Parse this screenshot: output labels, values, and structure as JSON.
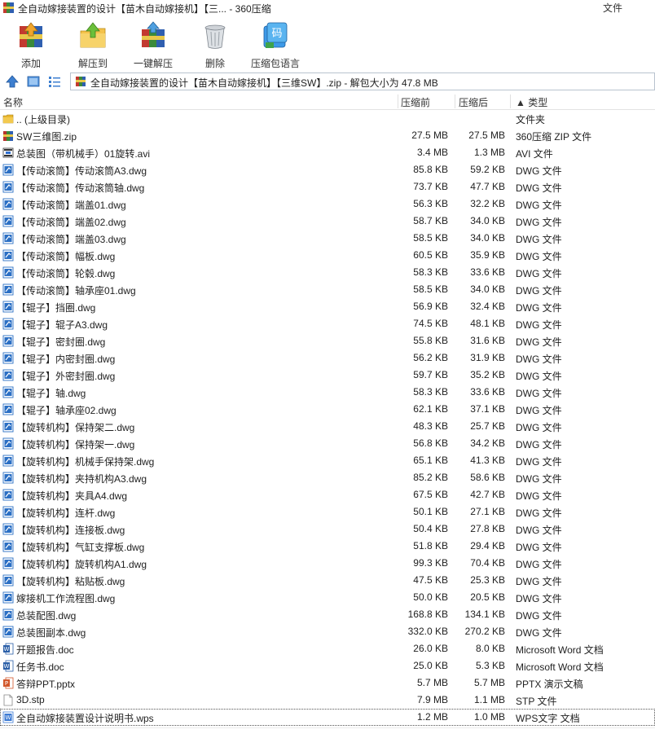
{
  "window": {
    "title": "全自动嫁接装置的设计【苗木自动嫁接机】【三... - 360压缩",
    "menu_file": "文件"
  },
  "toolbar": {
    "buttons": [
      {
        "label": "添加",
        "icon": "add-archive-icon"
      },
      {
        "label": "解压到",
        "icon": "extract-to-folder-icon"
      },
      {
        "label": "一键解压",
        "icon": "one-click-extract-icon"
      },
      {
        "label": "删除",
        "icon": "trash-bin-icon"
      },
      {
        "label": "压缩包语言",
        "icon": "archive-language-icon"
      }
    ],
    "language_badge": "码"
  },
  "address": {
    "path": "全自动嫁接装置的设计【苗木自动嫁接机】【三维SW】.zip - 解包大小为 47.8 MB"
  },
  "columns": {
    "name": "名称",
    "size": "压缩前",
    "compressed": "压缩后",
    "type": "▲ 类型"
  },
  "colors": {
    "folder": "#e8b62f",
    "dwg_blue": "#2b6fc4",
    "word_blue": "#2b5fa8",
    "ppt_orange": "#d2562a",
    "wps_blue": "#3d7bd4",
    "winrar_red": "#b8322c"
  },
  "files": [
    {
      "name": ".. (上级目录)",
      "size": "",
      "csize": "",
      "type": "文件夹",
      "icon": "folder-icon"
    },
    {
      "name": "SW三维图.zip",
      "size": "27.5 MB",
      "csize": "27.5 MB",
      "type": "360压缩 ZIP 文件",
      "icon": "zip-icon"
    },
    {
      "name": "总装图（带机械手）01旋转.avi",
      "size": "3.4 MB",
      "csize": "1.3 MB",
      "type": "AVI 文件",
      "icon": "video-file-icon"
    },
    {
      "name": "【传动滚筒】传动滚筒A3.dwg",
      "size": "85.8 KB",
      "csize": "59.2 KB",
      "type": "DWG 文件",
      "icon": "dwg-file-icon"
    },
    {
      "name": "【传动滚筒】传动滚筒轴.dwg",
      "size": "73.7 KB",
      "csize": "47.7 KB",
      "type": "DWG 文件",
      "icon": "dwg-file-icon"
    },
    {
      "name": "【传动滚筒】端盖01.dwg",
      "size": "56.3 KB",
      "csize": "32.2 KB",
      "type": "DWG 文件",
      "icon": "dwg-file-icon"
    },
    {
      "name": "【传动滚筒】端盖02.dwg",
      "size": "58.7 KB",
      "csize": "34.0 KB",
      "type": "DWG 文件",
      "icon": "dwg-file-icon"
    },
    {
      "name": "【传动滚筒】端盖03.dwg",
      "size": "58.5 KB",
      "csize": "34.0 KB",
      "type": "DWG 文件",
      "icon": "dwg-file-icon"
    },
    {
      "name": "【传动滚筒】幅板.dwg",
      "size": "60.5 KB",
      "csize": "35.9 KB",
      "type": "DWG 文件",
      "icon": "dwg-file-icon"
    },
    {
      "name": "【传动滚筒】轮毂.dwg",
      "size": "58.3 KB",
      "csize": "33.6 KB",
      "type": "DWG 文件",
      "icon": "dwg-file-icon"
    },
    {
      "name": "【传动滚筒】轴承座01.dwg",
      "size": "58.5 KB",
      "csize": "34.0 KB",
      "type": "DWG 文件",
      "icon": "dwg-file-icon"
    },
    {
      "name": "【辊子】挡圈.dwg",
      "size": "56.9 KB",
      "csize": "32.4 KB",
      "type": "DWG 文件",
      "icon": "dwg-file-icon"
    },
    {
      "name": "【辊子】辊子A3.dwg",
      "size": "74.5 KB",
      "csize": "48.1 KB",
      "type": "DWG 文件",
      "icon": "dwg-file-icon"
    },
    {
      "name": "【辊子】密封圈.dwg",
      "size": "55.8 KB",
      "csize": "31.6 KB",
      "type": "DWG 文件",
      "icon": "dwg-file-icon"
    },
    {
      "name": "【辊子】内密封圈.dwg",
      "size": "56.2 KB",
      "csize": "31.9 KB",
      "type": "DWG 文件",
      "icon": "dwg-file-icon"
    },
    {
      "name": "【辊子】外密封圈.dwg",
      "size": "59.7 KB",
      "csize": "35.2 KB",
      "type": "DWG 文件",
      "icon": "dwg-file-icon"
    },
    {
      "name": "【辊子】轴.dwg",
      "size": "58.3 KB",
      "csize": "33.6 KB",
      "type": "DWG 文件",
      "icon": "dwg-file-icon"
    },
    {
      "name": "【辊子】轴承座02.dwg",
      "size": "62.1 KB",
      "csize": "37.1 KB",
      "type": "DWG 文件",
      "icon": "dwg-file-icon"
    },
    {
      "name": "【旋转机构】保持架二.dwg",
      "size": "48.3 KB",
      "csize": "25.7 KB",
      "type": "DWG 文件",
      "icon": "dwg-file-icon"
    },
    {
      "name": "【旋转机构】保持架一.dwg",
      "size": "56.8 KB",
      "csize": "34.2 KB",
      "type": "DWG 文件",
      "icon": "dwg-file-icon"
    },
    {
      "name": "【旋转机构】机械手保持架.dwg",
      "size": "65.1 KB",
      "csize": "41.3 KB",
      "type": "DWG 文件",
      "icon": "dwg-file-icon"
    },
    {
      "name": "【旋转机构】夹持机构A3.dwg",
      "size": "85.2 KB",
      "csize": "58.6 KB",
      "type": "DWG 文件",
      "icon": "dwg-file-icon"
    },
    {
      "name": "【旋转机构】夹具A4.dwg",
      "size": "67.5 KB",
      "csize": "42.7 KB",
      "type": "DWG 文件",
      "icon": "dwg-file-icon"
    },
    {
      "name": "【旋转机构】连杆.dwg",
      "size": "50.1 KB",
      "csize": "27.1 KB",
      "type": "DWG 文件",
      "icon": "dwg-file-icon"
    },
    {
      "name": "【旋转机构】连接板.dwg",
      "size": "50.4 KB",
      "csize": "27.8 KB",
      "type": "DWG 文件",
      "icon": "dwg-file-icon"
    },
    {
      "name": "【旋转机构】气缸支撑板.dwg",
      "size": "51.8 KB",
      "csize": "29.4 KB",
      "type": "DWG 文件",
      "icon": "dwg-file-icon"
    },
    {
      "name": "【旋转机构】旋转机构A1.dwg",
      "size": "99.3 KB",
      "csize": "70.4 KB",
      "type": "DWG 文件",
      "icon": "dwg-file-icon"
    },
    {
      "name": "【旋转机构】粘贴板.dwg",
      "size": "47.5 KB",
      "csize": "25.3 KB",
      "type": "DWG 文件",
      "icon": "dwg-file-icon"
    },
    {
      "name": "嫁接机工作流程图.dwg",
      "size": "50.0 KB",
      "csize": "20.5 KB",
      "type": "DWG 文件",
      "icon": "dwg-file-icon"
    },
    {
      "name": "总装配图.dwg",
      "size": "168.8 KB",
      "csize": "134.1 KB",
      "type": "DWG 文件",
      "icon": "dwg-file-icon"
    },
    {
      "name": "总装图副本.dwg",
      "size": "332.0 KB",
      "csize": "270.2 KB",
      "type": "DWG 文件",
      "icon": "dwg-file-icon"
    },
    {
      "name": "开题报告.doc",
      "size": "26.0 KB",
      "csize": "8.0 KB",
      "type": "Microsoft Word 文档",
      "icon": "word-doc-icon"
    },
    {
      "name": "任务书.doc",
      "size": "25.0 KB",
      "csize": "5.3 KB",
      "type": "Microsoft Word 文档",
      "icon": "word-doc-icon"
    },
    {
      "name": "答辩PPT.pptx",
      "size": "5.7 MB",
      "csize": "5.7 MB",
      "type": "PPTX 演示文稿",
      "icon": "pptx-file-icon"
    },
    {
      "name": "3D.stp",
      "size": "7.9 MB",
      "csize": "1.1 MB",
      "type": "STP 文件",
      "icon": "blank-file-icon"
    },
    {
      "name": "全自动嫁接装置设计说明书.wps",
      "size": "1.2 MB",
      "csize": "1.0 MB",
      "type": "WPS文字 文档",
      "icon": "wps-doc-icon"
    }
  ]
}
